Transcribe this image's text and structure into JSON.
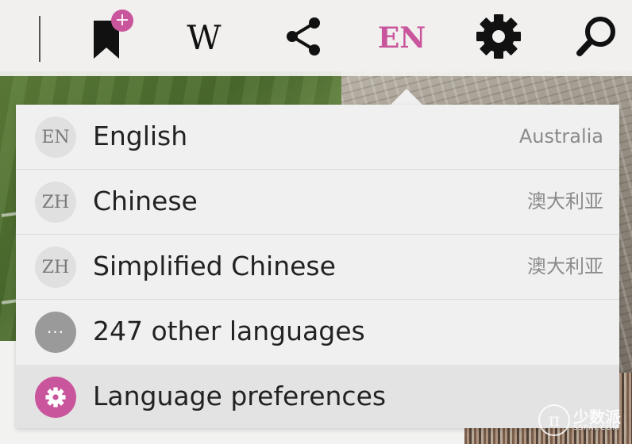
{
  "colors": {
    "accent": "#c9559c",
    "icon": "#111111",
    "toolbar_bg": "#f2f2f0",
    "menu_bg": "#f0f0f0",
    "menu_active_bg": "#e3e3e3",
    "label": "#222222",
    "region": "#8a8a8a"
  },
  "toolbar": {
    "bookmark": {
      "icon": "bookmark-add-icon",
      "badge": "+"
    },
    "wikipedia": {
      "icon": "wikipedia-icon",
      "label": "W"
    },
    "share": {
      "icon": "share-icon"
    },
    "language": {
      "label": "EN"
    },
    "settings": {
      "icon": "gear-icon"
    },
    "search": {
      "icon": "search-icon"
    }
  },
  "language_menu": {
    "items": [
      {
        "code": "EN",
        "name": "English",
        "region": "Australia"
      },
      {
        "code": "ZH",
        "name": "Chinese",
        "region": "澳大利亚"
      },
      {
        "code": "ZH",
        "name": "Simplified Chinese",
        "region": "澳大利亚"
      },
      {
        "icon": "more-icon",
        "badge": "···",
        "name": "247 other languages"
      },
      {
        "icon": "gear-icon",
        "name": "Language preferences"
      }
    ]
  },
  "watermark": {
    "logo": "π",
    "main": "少数派",
    "sub": "SSPAI.COM"
  }
}
